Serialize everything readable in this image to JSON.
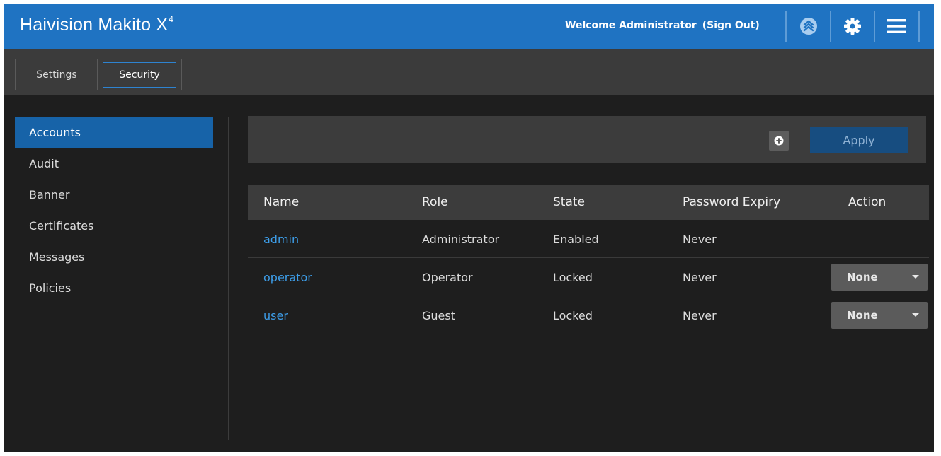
{
  "header": {
    "brand_main": "Haivision Makito X",
    "brand_sup": "4",
    "welcome_text": "Welcome Administrator",
    "signout_label": "(Sign Out)",
    "icons": [
      "status-icon",
      "gear-icon",
      "menu-icon"
    ]
  },
  "tabs": [
    {
      "label": "Settings",
      "active": false
    },
    {
      "label": "Security",
      "active": true
    }
  ],
  "sidebar": {
    "items": [
      {
        "label": "Accounts",
        "active": true
      },
      {
        "label": "Audit",
        "active": false
      },
      {
        "label": "Banner",
        "active": false
      },
      {
        "label": "Certificates",
        "active": false
      },
      {
        "label": "Messages",
        "active": false
      },
      {
        "label": "Policies",
        "active": false
      }
    ]
  },
  "toolbar": {
    "add_icon": "plus-circle-icon",
    "apply_label": "Apply"
  },
  "table": {
    "columns": [
      "Name",
      "Role",
      "State",
      "Password Expiry",
      "Action"
    ],
    "rows": [
      {
        "name": "admin",
        "role": "Administrator",
        "state": "Enabled",
        "expiry": "Never",
        "action": null
      },
      {
        "name": "operator",
        "role": "Operator",
        "state": "Locked",
        "expiry": "Never",
        "action": "None"
      },
      {
        "name": "user",
        "role": "Guest",
        "state": "Locked",
        "expiry": "Never",
        "action": "None"
      }
    ]
  },
  "colors": {
    "header_bg": "#1f73c2",
    "accent": "#2e83d0",
    "link": "#3d9de8",
    "panel_bg": "#1e1e1e",
    "apply_bg": "#174d80"
  }
}
